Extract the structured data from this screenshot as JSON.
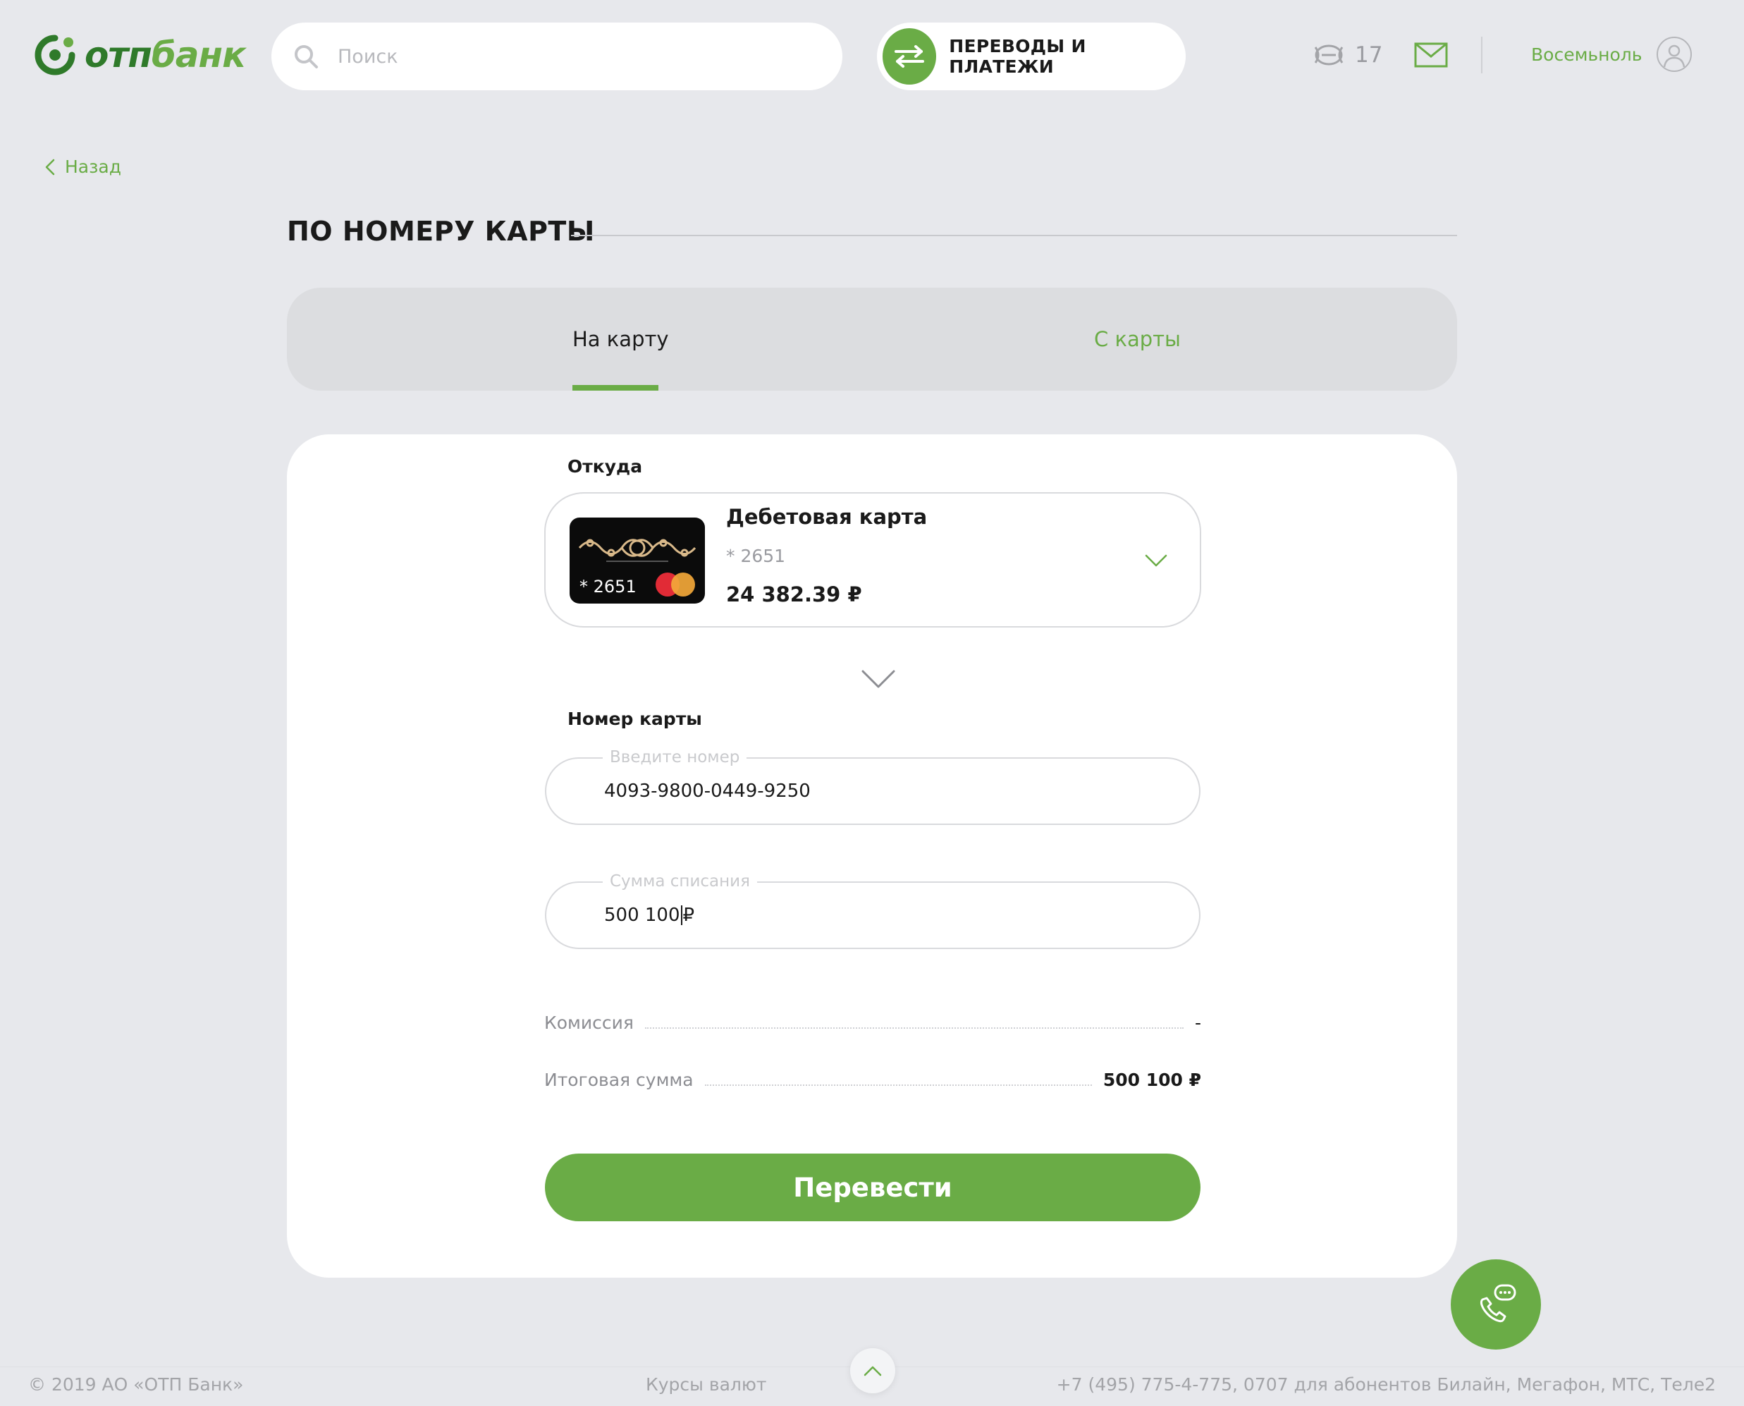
{
  "brand": {
    "logo_otp": "отп",
    "logo_bank": "банк",
    "colors": {
      "accent": "#6aac46",
      "accent_dark": "#2f7a2a",
      "background": "#e7e8ec"
    }
  },
  "header": {
    "search_placeholder": "Поиск",
    "transfers_label": "ПЕРЕВОДЫ И ПЛАТЕЖИ",
    "notifications_count": "17",
    "user_name": "Восемьноль"
  },
  "nav": {
    "back_label": "Назад"
  },
  "page": {
    "title": "ПО НОМЕРУ КАРТЫ"
  },
  "tabs": [
    {
      "label": "На карту",
      "active": true
    },
    {
      "label": "С карты",
      "active": false
    }
  ],
  "form": {
    "from_label": "Откуда",
    "source": {
      "title": "Дебетовая карта",
      "mask": "* 2651",
      "balance": "24 382.39 ₽",
      "card_number_on_image": "* 2651"
    },
    "card_number_label": "Номер карты",
    "card_number": {
      "legend": "Введите номер",
      "value": "4093-9800-0449-9250"
    },
    "amount": {
      "legend": "Сумма списания",
      "value": "500 100",
      "currency": "₽"
    },
    "fee": {
      "label": "Комиссия",
      "value": "-"
    },
    "total": {
      "label": "Итоговая сумма",
      "value": "500 100 ₽"
    },
    "submit_label": "Перевести"
  },
  "footer": {
    "copyright": "© 2019 АО «ОТП Банк»",
    "rates": "Курсы валют",
    "phones": "+7 (495) 775-4-775,  0707 для абонентов Билайн, Мегафон, МТС, Теле2"
  },
  "icons": [
    "search-icon",
    "transfer-arrows-icon",
    "notification-icon",
    "mail-icon",
    "avatar-icon",
    "chevron-left-icon",
    "chevron-down-icon",
    "mastercard-icon",
    "call-chat-icon",
    "chevron-up-icon"
  ]
}
